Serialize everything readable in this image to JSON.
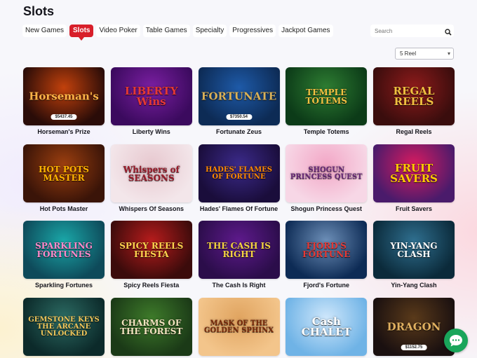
{
  "page": {
    "title": "Slots"
  },
  "tabs": [
    {
      "label": "New Games",
      "active": false
    },
    {
      "label": "Slots",
      "active": true
    },
    {
      "label": "Video Poker",
      "active": false
    },
    {
      "label": "Table Games",
      "active": false
    },
    {
      "label": "Specialty",
      "active": false
    },
    {
      "label": "Progressives",
      "active": false
    },
    {
      "label": "Jackpot Games",
      "active": false
    }
  ],
  "search": {
    "placeholder": "Search"
  },
  "filter": {
    "selected": "5 Reel"
  },
  "games": [
    {
      "name": "Horseman's Prize",
      "logo": "Horseman's",
      "jackpot": "$5437.45"
    },
    {
      "name": "Liberty Wins",
      "logo": "LIBERTY Wins",
      "jackpot": ""
    },
    {
      "name": "Fortunate Zeus",
      "logo": "FORTUNATE",
      "jackpot": "$7350.54"
    },
    {
      "name": "Temple Totems",
      "logo": "TEMPLE TOTEMS",
      "jackpot": ""
    },
    {
      "name": "Regal Reels",
      "logo": "REGAL REELS",
      "jackpot": ""
    },
    {
      "name": "Hot Pots Master",
      "logo": "HOT POTS MASTER",
      "jackpot": ""
    },
    {
      "name": "Whispers Of Seasons",
      "logo": "Whispers of SEASONS",
      "jackpot": ""
    },
    {
      "name": "Hades' Flames Of Fortune",
      "logo": "HADES' FLAMES OF FORTUNE",
      "jackpot": ""
    },
    {
      "name": "Shogun Princess Quest",
      "logo": "SHOGUN PRINCESS QUEST",
      "jackpot": ""
    },
    {
      "name": "Fruit Savers",
      "logo": "FRUIT SAVERS",
      "jackpot": ""
    },
    {
      "name": "Sparkling Fortunes",
      "logo": "SPARKLING FORTUNES",
      "jackpot": ""
    },
    {
      "name": "Spicy Reels Fiesta",
      "logo": "SPICY REELS FIESTA",
      "jackpot": ""
    },
    {
      "name": "The Cash Is Right",
      "logo": "THE CASH IS RIGHT",
      "jackpot": ""
    },
    {
      "name": "Fjord's Fortune",
      "logo": "FJORD'S FORTUNE",
      "jackpot": ""
    },
    {
      "name": "Yin-Yang Clash",
      "logo": "YIN-YANG CLASH",
      "jackpot": ""
    },
    {
      "name": "",
      "logo": "GEMSTONE KEYS THE ARCANE UNLOCKED",
      "jackpot": ""
    },
    {
      "name": "",
      "logo": "CHARMS OF THE FOREST",
      "jackpot": ""
    },
    {
      "name": "",
      "logo": "MASK OF THE GOLDEN SPHINX",
      "jackpot": ""
    },
    {
      "name": "",
      "logo": "Cash CHALET",
      "jackpot": ""
    },
    {
      "name": "",
      "logo": "DRAGON",
      "jackpot": "$1152.75"
    }
  ],
  "theme": {
    "active_tab": "#d81f2a",
    "chat_button": "#19a55a",
    "thumbs": [
      [
        "#2a0c08",
        "#c2410c",
        "#ffb347"
      ],
      [
        "#3b0a5e",
        "#7b1fa2",
        "#e53935"
      ],
      [
        "#0d2b55",
        "#1e5aa8",
        "#d9b15a"
      ],
      [
        "#0c3b18",
        "#2e7d32",
        "#f5c242"
      ],
      [
        "#3a0d0d",
        "#8e1b1b",
        "#f0c040"
      ],
      [
        "#3a1408",
        "#9c3f0f",
        "#ffb300"
      ],
      [
        "#f3e6ea",
        "#e7c8cf",
        "#9b1c2b"
      ],
      [
        "#1a0d3b",
        "#3b2a8a",
        "#ff8a00"
      ],
      [
        "#f7d7e6",
        "#f2a7c6",
        "#6a2a7a"
      ],
      [
        "#4a1b6b",
        "#d81b60",
        "#ffcc00"
      ],
      [
        "#0e4a5a",
        "#1aa7a8",
        "#ff8acb"
      ],
      [
        "#3b0b0b",
        "#b71c1c",
        "#ffd54f"
      ],
      [
        "#2b0d4a",
        "#5e1a8c",
        "#f5d442"
      ],
      [
        "#0d2b55",
        "#6d8fb8",
        "#e53935"
      ],
      [
        "#0b2a3a",
        "#2f6f8f",
        "#ffffff"
      ],
      [
        "#0c2a2a",
        "#2c6b63",
        "#f1c75b"
      ],
      [
        "#1b3a17",
        "#3e7b2a",
        "#f3e3c0"
      ],
      [
        "#f3c58b",
        "#e0a460",
        "#7a2a0a"
      ],
      [
        "#6fb3e6",
        "#cfe7fb",
        "#ffffff"
      ],
      [
        "#1a1010",
        "#5a3a1a",
        "#e0b060"
      ]
    ]
  }
}
